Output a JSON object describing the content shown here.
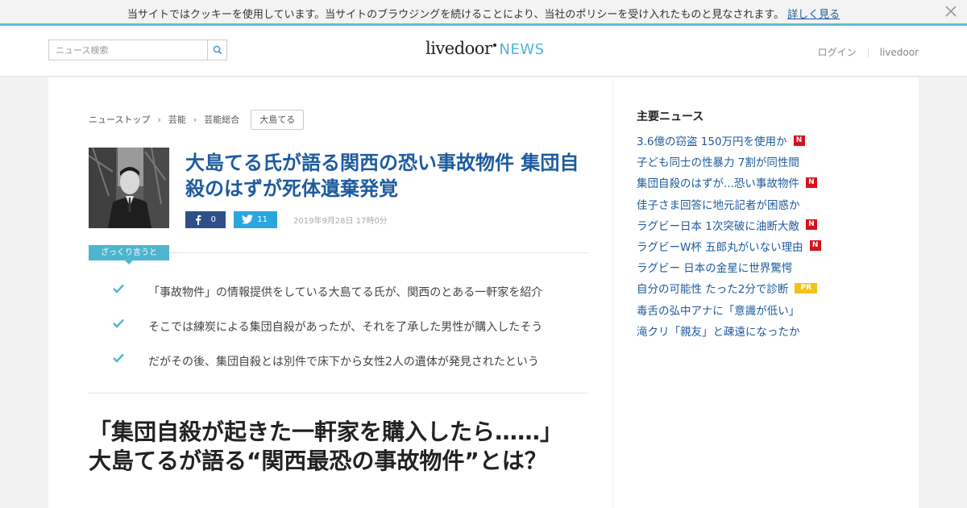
{
  "cookie_bar": {
    "message": "当サイトではクッキーを使用しています。当サイトのブラウジングを続けることにより、当社のポリシーを受け入れたものと見なされます。",
    "link": "詳しく見る"
  },
  "header": {
    "search_placeholder": "ニュース検索",
    "logo_main": "livedoor",
    "logo_sub": "NEWS",
    "login": "ログイン",
    "livedoor_link": "livedoor"
  },
  "breadcrumb": {
    "items": [
      "ニューストップ",
      "芸能",
      "芸能総合"
    ],
    "tag": "大島てる"
  },
  "article": {
    "title": "大島てる氏が語る関西の恐い事故物件 集団自殺のはずが死体遺棄発覚",
    "facebook_count": "0",
    "twitter_count": "11",
    "date": "2019年9月28日 17時0分",
    "summary_label": "ざっくり言うと",
    "summary": [
      "「事故物件」の情報提供をしている大島てる氏が、関西のとある一軒家を紹介",
      "そこでは練炭による集団自殺があったが、それを了承した男性が購入したそう",
      "だがその後、集団自殺とは別件で床下から女性2人の遺体が発見されたという"
    ],
    "headline": "「集団自殺が起きた一軒家を購入したら……」大島てるが語る“関西最恐の事故物件”とは？"
  },
  "sidebar": {
    "title": "主要ニュース",
    "items": [
      {
        "label": "3.6億の窃盗 150万円を使用か",
        "badge": "N"
      },
      {
        "label": "子ども同士の性暴力 7割が同性間",
        "badge": ""
      },
      {
        "label": "集団自殺のはずが...恐い事故物件",
        "badge": "N"
      },
      {
        "label": "佳子さま回答に地元記者が困惑か",
        "badge": ""
      },
      {
        "label": "ラグビー日本 1次突破に油断大敵",
        "badge": "N"
      },
      {
        "label": "ラグビーW杯 五郎丸がいない理由",
        "badge": "N"
      },
      {
        "label": "ラグビー 日本の金星に世界驚愕",
        "badge": ""
      },
      {
        "label": "自分の可能性 たった2分で診断",
        "badge": "PR"
      },
      {
        "label": "毒舌の弘中アナに「意識が低い」",
        "badge": ""
      },
      {
        "label": "滝クリ「親友」と疎遠になったか",
        "badge": ""
      }
    ]
  },
  "colors": {
    "accent": "#4eb5cf",
    "link": "#1d5b9e",
    "badge_new": "#d6121a",
    "badge_pr": "#f0c21b",
    "facebook": "#2e4f8a",
    "twitter": "#2aa6df"
  }
}
